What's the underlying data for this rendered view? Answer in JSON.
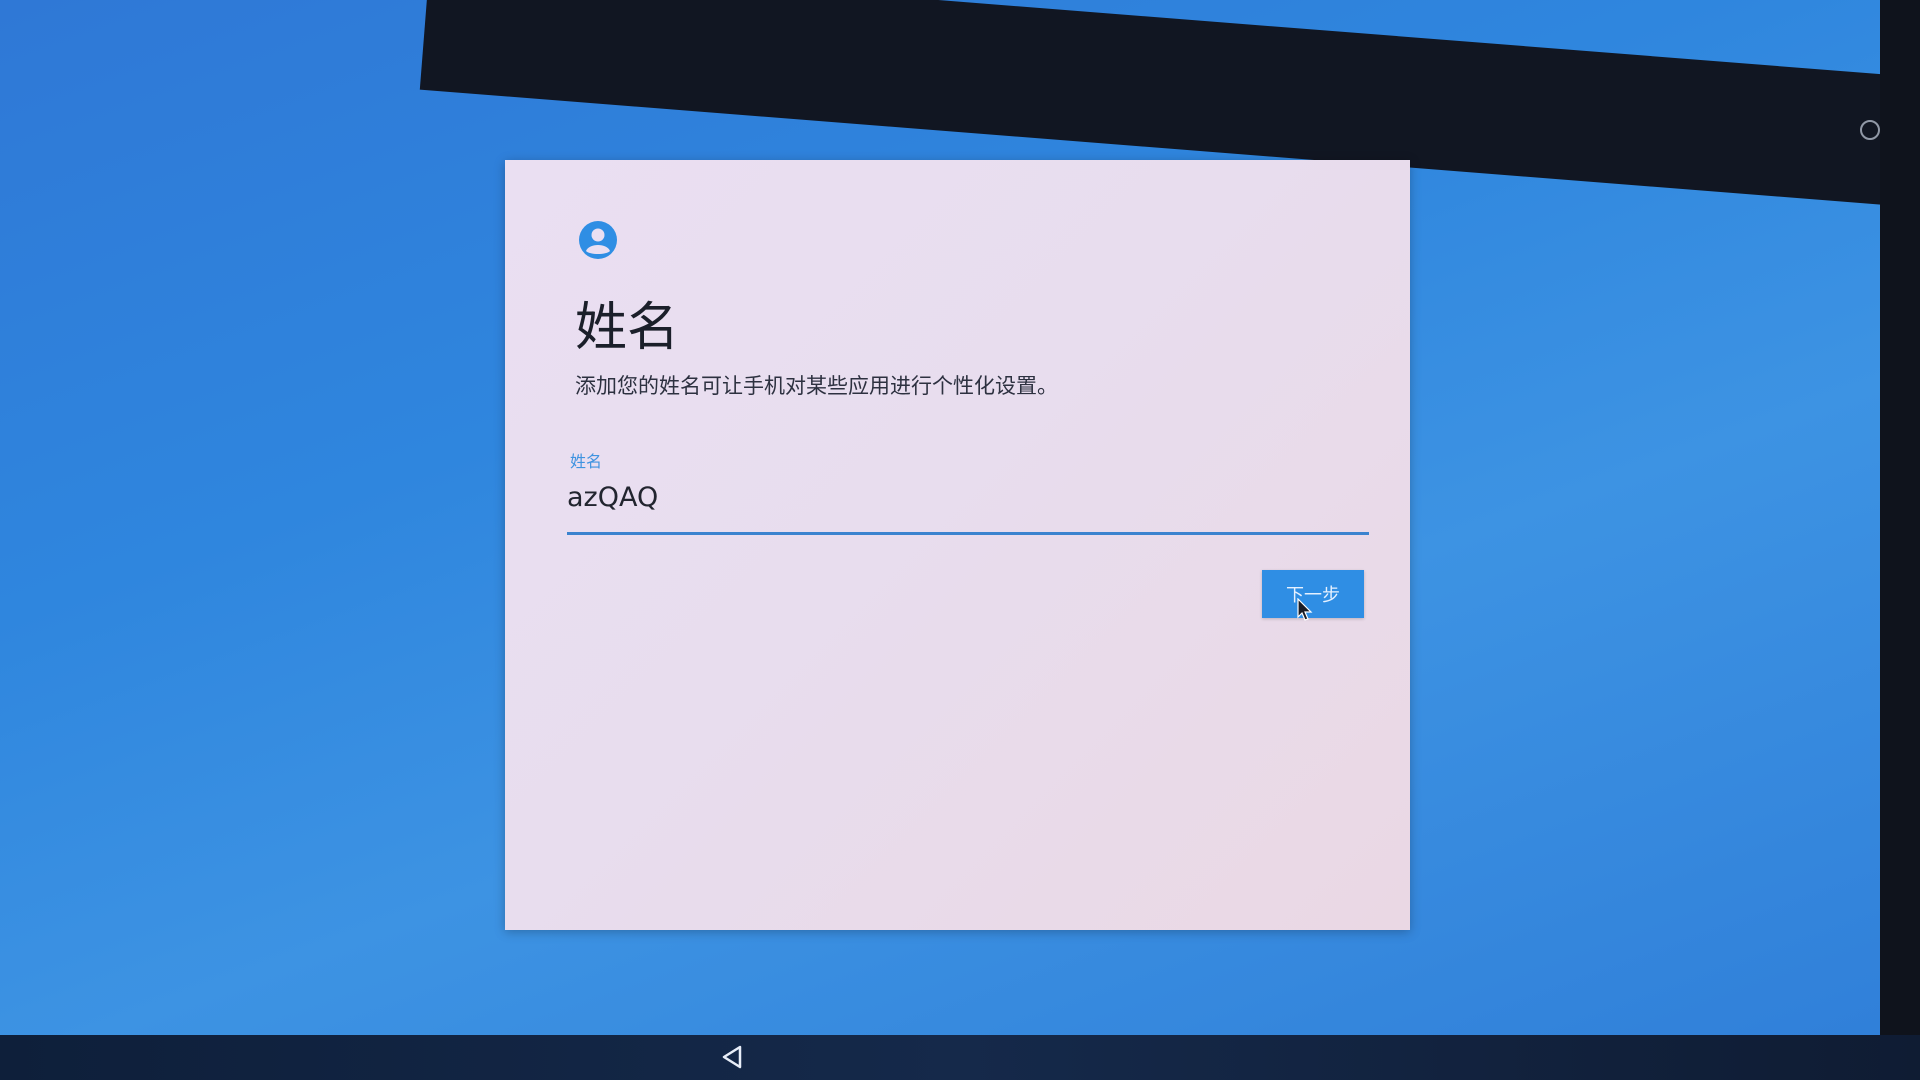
{
  "setup": {
    "title": "姓名",
    "description": "添加您的姓名可让手机对某些应用进行个性化设置。",
    "field_label": "姓名",
    "field_value": "azQAQ",
    "next_label": "下一步"
  },
  "icons": {
    "avatar": "account-circle-icon",
    "back": "back-triangle-icon",
    "cursor": "mouse-pointer-icon",
    "status": "status-icon"
  },
  "colors": {
    "accent": "#2f8ee4",
    "background": "#2f86de",
    "card": "#eadff2"
  }
}
